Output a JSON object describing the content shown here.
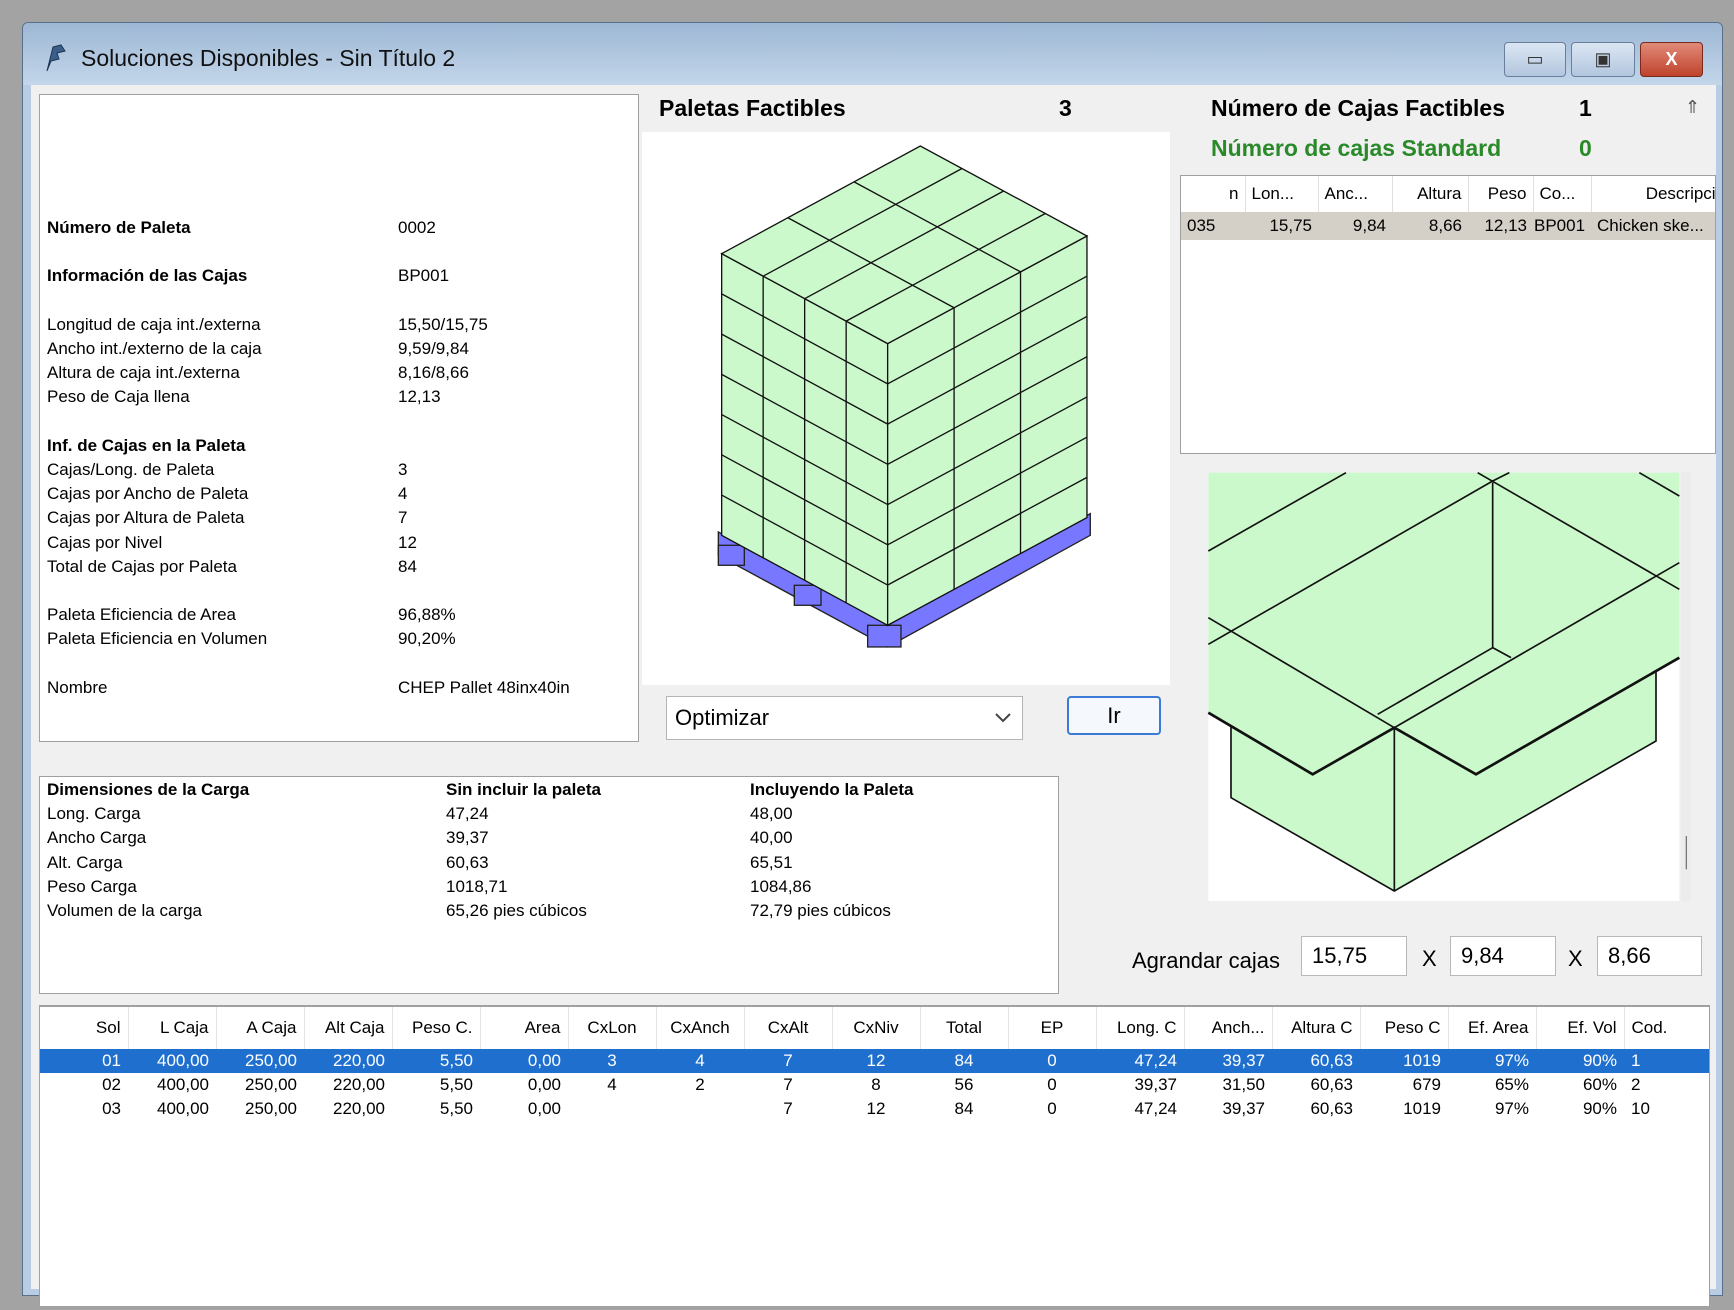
{
  "window": {
    "title": "Soluciones Disponibles - Sin Título 2",
    "minimize_icon": "minimize-icon",
    "maximize_icon": "restore-icon",
    "close_icon": "close-icon",
    "close_label": "X"
  },
  "info": {
    "sections": [
      [
        {
          "label": "Número de Paleta",
          "value": "0002",
          "bold": true
        }
      ],
      [
        {
          "label": "Información de las Cajas",
          "value": "BP001",
          "bold": true
        }
      ],
      [
        {
          "label": "Longitud de caja int./externa",
          "value": "15,50/15,75"
        },
        {
          "label": "Ancho int./externo de la caja",
          "value": "9,59/9,84"
        },
        {
          "label": "Altura de caja int./externa",
          "value": "8,16/8,66"
        },
        {
          "label": "Peso de Caja llena",
          "value": "12,13"
        }
      ],
      [
        {
          "label": "Inf. de Cajas en la Paleta",
          "value": "",
          "bold": true
        },
        {
          "label": "Cajas/Long. de Paleta",
          "value": "3"
        },
        {
          "label": "Cajas por Ancho de Paleta",
          "value": "4"
        },
        {
          "label": "Cajas por Altura de Paleta",
          "value": "7"
        },
        {
          "label": "Cajas por Nivel",
          "value": "12"
        },
        {
          "label": "Total de Cajas por Paleta",
          "value": "84"
        }
      ],
      [
        {
          "label": "Paleta Eficiencia de Area",
          "value": "96,88%"
        },
        {
          "label": "Paleta Eficiencia en Volumen",
          "value": "90,20%"
        }
      ],
      [
        {
          "label": "Nombre",
          "value": "CHEP Pallet 48inx40in"
        }
      ]
    ]
  },
  "pallets": {
    "label": "Paletas Factibles",
    "count": "3",
    "box_color": "#ccf9cc",
    "pallet_color": "#7777ff"
  },
  "optimize": {
    "selected": "Optimizar",
    "go_label": "Ir"
  },
  "cases": {
    "label": "Número de Cajas Factibles",
    "count": "1",
    "standard_label": "Número de cajas Standard",
    "standard_count": "0",
    "standard_color": "#2a8a2a"
  },
  "case_table": {
    "columns": [
      "n",
      "Lon...",
      "Anc...",
      "Altura",
      "Peso",
      "Co...",
      "Descripción"
    ],
    "rows": [
      [
        "035",
        "15,75",
        "9,84",
        "8,66",
        "12,13",
        "BP001",
        "Chicken ske..."
      ]
    ]
  },
  "dimensions": {
    "headers": [
      "Dimensiones de la Carga",
      "Sin incluir la paleta",
      "Incluyendo la Paleta"
    ],
    "rows": [
      [
        "Long. Carga",
        "47,24",
        "48,00"
      ],
      [
        "Ancho Carga",
        "39,37",
        "40,00"
      ],
      [
        "Alt. Carga",
        "60,63",
        "65,51"
      ],
      [
        "Peso Carga",
        "1018,71",
        "1084,86"
      ],
      [
        "Volumen de la carga",
        "65,26 pies cúbicos",
        "72,79 pies cúbicos"
      ]
    ]
  },
  "enlarge": {
    "label": "Agrandar cajas",
    "x1": "15,75",
    "sep": "X",
    "x2": "9,84",
    "x3": "8,66"
  },
  "solutions": {
    "columns": [
      "Sol",
      "L Caja",
      "A Caja",
      "Alt Caja",
      "Peso C.",
      "Area",
      "CxLon",
      "CxAnch",
      "CxAlt",
      "CxNiv",
      "Total",
      "EP",
      "Long. C",
      "Anch...",
      "Altura C",
      "Peso C",
      "Ef. Area",
      "Ef. Vol",
      "Cod."
    ],
    "rows": [
      [
        "01",
        "400,00",
        "250,00",
        "220,00",
        "5,50",
        "0,00",
        "3",
        "4",
        "7",
        "12",
        "84",
        "0",
        "47,24",
        "39,37",
        "60,63",
        "1019",
        "97%",
        "90%",
        "1"
      ],
      [
        "02",
        "400,00",
        "250,00",
        "220,00",
        "5,50",
        "0,00",
        "4",
        "2",
        "7",
        "8",
        "56",
        "0",
        "39,37",
        "31,50",
        "60,63",
        "679",
        "65%",
        "60%",
        "2"
      ],
      [
        "03",
        "400,00",
        "250,00",
        "220,00",
        "5,50",
        "0,00",
        "",
        "",
        "7",
        "12",
        "84",
        "0",
        "47,24",
        "39,37",
        "60,63",
        "1019",
        "97%",
        "90%",
        "10"
      ]
    ],
    "selected_row": 0,
    "selected_color": "#1f6fcf"
  }
}
